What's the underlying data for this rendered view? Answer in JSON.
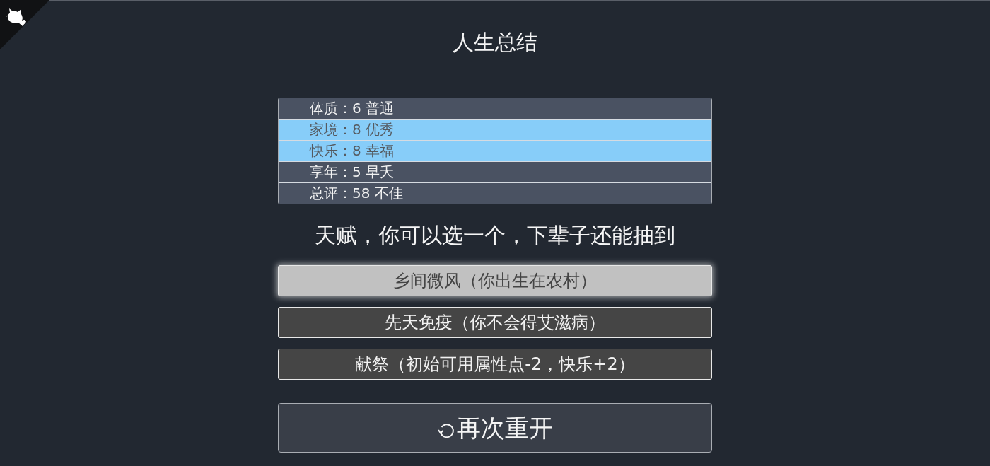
{
  "title": "人生总结",
  "summary": [
    {
      "text": "体质：6 普通",
      "color": "#4a5262"
    },
    {
      "text": "家境：8 优秀",
      "color": "#87cdf9"
    },
    {
      "text": "快乐：8 幸福",
      "color": "#87cdf9"
    },
    {
      "text": "享年：5 早夭",
      "color": "#4a5262"
    },
    {
      "text": "总评：58 不佳",
      "color": "#4a5262"
    }
  ],
  "talent_prompt": "天赋，你可以选一个，下辈子还能抽到",
  "talents": [
    {
      "label": "乡间微风（你出生在农村）",
      "selected": true
    },
    {
      "label": "先天免疫（你不会得艾滋病）",
      "selected": false
    },
    {
      "label": "献祭（初始可用属性点-2，快乐+2）",
      "selected": false
    }
  ],
  "restart_button": {
    "label": "再次重开"
  }
}
